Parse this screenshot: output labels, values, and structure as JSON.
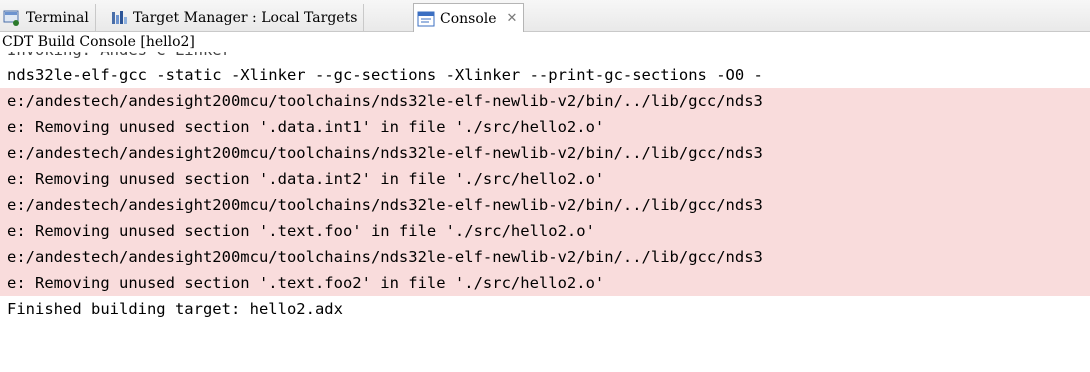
{
  "tabs": [
    {
      "label": "Terminal",
      "icon": "terminal-icon",
      "active": false
    },
    {
      "label": "Target Manager : Local Targets",
      "icon": "target-manager-icon",
      "active": false
    },
    {
      "label": "Console",
      "icon": "console-icon",
      "active": true,
      "close": "✕"
    }
  ],
  "console": {
    "title": "CDT Build Console [hello2]",
    "partial_line": "Invoking: Andes C Linker",
    "lines": [
      {
        "text": "nds32le-elf-gcc -static -Xlinker --gc-sections -Xlinker --print-gc-sections -O0 -",
        "error": false
      },
      {
        "text": "e:/andestech/andesight200mcu/toolchains/nds32le-elf-newlib-v2/bin/../lib/gcc/nds3",
        "error": true
      },
      {
        "text": "e: Removing unused section '.data.int1' in file './src/hello2.o'",
        "error": true
      },
      {
        "text": "e:/andestech/andesight200mcu/toolchains/nds32le-elf-newlib-v2/bin/../lib/gcc/nds3",
        "error": true
      },
      {
        "text": "e: Removing unused section '.data.int2' in file './src/hello2.o'",
        "error": true
      },
      {
        "text": "e:/andestech/andesight200mcu/toolchains/nds32le-elf-newlib-v2/bin/../lib/gcc/nds3",
        "error": true
      },
      {
        "text": "e: Removing unused section '.text.foo' in file './src/hello2.o'",
        "error": true
      },
      {
        "text": "e:/andestech/andesight200mcu/toolchains/nds32le-elf-newlib-v2/bin/../lib/gcc/nds3",
        "error": true
      },
      {
        "text": "e: Removing unused section '.text.foo2' in file './src/hello2.o'",
        "error": true
      },
      {
        "text": "Finished building target: hello2.adx",
        "error": false
      }
    ]
  },
  "colors": {
    "error_bg": "#f9dcdc",
    "tab_border": "#b5b5b5"
  }
}
